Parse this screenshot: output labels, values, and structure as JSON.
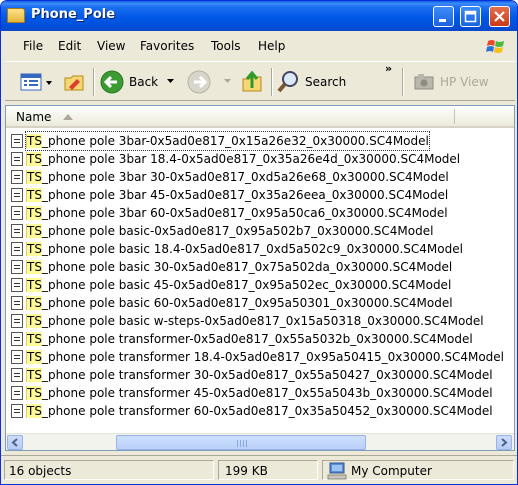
{
  "window": {
    "title": "Phone_Pole"
  },
  "menu": [
    "File",
    "Edit",
    "View",
    "Favorites",
    "Tools",
    "Help"
  ],
  "toolbar": {
    "back_label": "Back",
    "search_label": "Search",
    "more": "»",
    "hpview_label": "HP View"
  },
  "list": {
    "column_name": "Name",
    "prefix": "TS",
    "files": [
      "_phone pole 3bar-0x5ad0e817_0x15a26e32_0x30000.SC4Model",
      "_phone pole 3bar 18.4-0x5ad0e817_0x35a26e4d_0x30000.SC4Model",
      "_phone pole 3bar 30-0x5ad0e817_0xd5a26e68_0x30000.SC4Model",
      "_phone pole 3bar 45-0x5ad0e817_0x35a26eea_0x30000.SC4Model",
      "_phone pole 3bar 60-0x5ad0e817_0x95a50ca6_0x30000.SC4Model",
      "_phone pole basic-0x5ad0e817_0x95a502b7_0x30000.SC4Model",
      "_phone pole basic 18.4-0x5ad0e817_0xd5a502c9_0x30000.SC4Model",
      "_phone pole basic 30-0x5ad0e817_0x75a502da_0x30000.SC4Model",
      "_phone pole basic 45-0x5ad0e817_0x95a502ec_0x30000.SC4Model",
      "_phone pole basic 60-0x5ad0e817_0x95a50301_0x30000.SC4Model",
      "_phone pole basic w-steps-0x5ad0e817_0x15a50318_0x30000.SC4Model",
      "_phone pole transformer-0x5ad0e817_0x55a5032b_0x30000.SC4Model",
      "_phone pole transformer 18.4-0x5ad0e817_0x95a50415_0x30000.SC4Model",
      "_phone pole transformer 30-0x5ad0e817_0x55a50427_0x30000.SC4Model",
      "_phone pole transformer 45-0x5ad0e817_0x55a5043b_0x30000.SC4Model",
      "_phone pole transformer 60-0x5ad0e817_0x35a50452_0x30000.SC4Model"
    ]
  },
  "status": {
    "count": "16 objects",
    "size": "199 KB",
    "zone": "My Computer"
  },
  "colors": {
    "titlebar": "#0058e6",
    "highlight": "#fffb99",
    "window_bg": "#ece9d8"
  },
  "icons": [
    "folder-icon",
    "minimize-icon",
    "maximize-icon",
    "close-icon",
    "windows-logo-icon",
    "views-icon",
    "folder-options-icon",
    "back-icon",
    "forward-icon",
    "up-folder-icon",
    "search-icon",
    "camera-icon",
    "file-icon",
    "computer-icon"
  ]
}
